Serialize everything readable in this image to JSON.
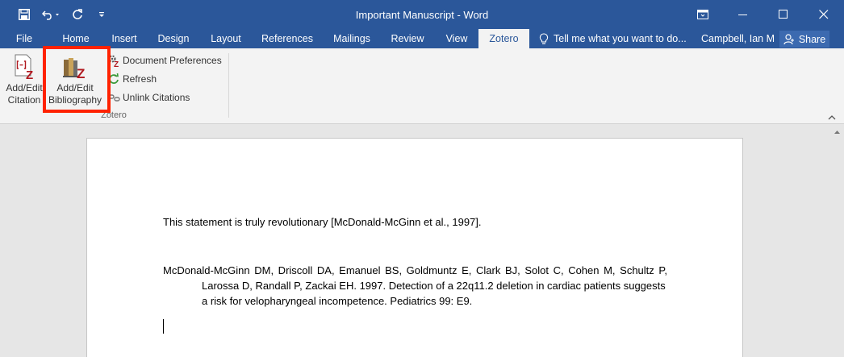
{
  "window": {
    "title": "Important Manuscript - Word"
  },
  "tabs": [
    {
      "label": "File"
    },
    {
      "label": "Home"
    },
    {
      "label": "Insert"
    },
    {
      "label": "Design"
    },
    {
      "label": "Layout"
    },
    {
      "label": "References"
    },
    {
      "label": "Mailings"
    },
    {
      "label": "Review"
    },
    {
      "label": "View"
    },
    {
      "label": "Zotero"
    }
  ],
  "active_tab": "Zotero",
  "tell_me": {
    "placeholder": "Tell me what you want to do..."
  },
  "user": {
    "name": "Campbell, Ian M"
  },
  "share": {
    "label": "Share"
  },
  "ribbon": {
    "add_edit_citation": {
      "line1": "Add/Edit",
      "line2": "Citation"
    },
    "add_edit_bibliography": {
      "line1": "Add/Edit",
      "line2": "Bibliography"
    },
    "document_preferences": "Document Preferences",
    "refresh": "Refresh",
    "unlink_citations": "Unlink Citations",
    "group_label": "Zotero"
  },
  "document": {
    "statement_text": "This statement is truly revolutionary ",
    "citation": "[McDonald-McGinn et al., 1997]",
    "statement_end": ".",
    "reference_lines": [
      "McDonald-McGinn DM, Driscoll DA, Emanuel BS, Goldmuntz E, Clark BJ, Solot C, Cohen M, Schultz P,",
      "Larossa D, Randall P, Zackai EH. 1997. Detection of a 22q11.2 deletion in cardiac patients suggests",
      "a risk for velopharyngeal incompetence. Pediatrics 99: E9."
    ]
  },
  "colors": {
    "title_bar": "#2b579a",
    "highlight": "#ff2200",
    "zotero_red": "#b0181f"
  }
}
